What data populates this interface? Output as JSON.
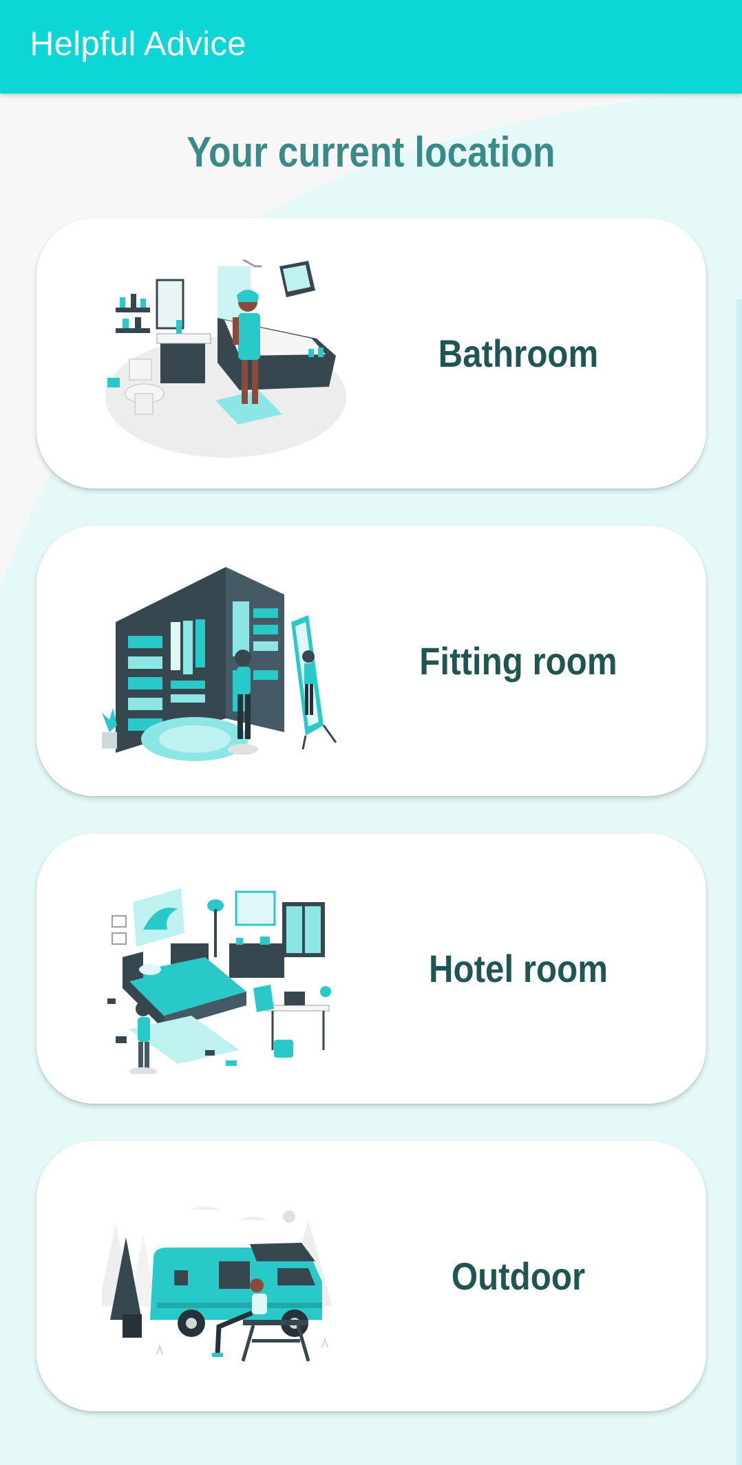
{
  "app_bar": {
    "title": "Helpful Advice"
  },
  "heading": "Your current location",
  "colors": {
    "app_bar": "#0cd6d6",
    "background": "#e6f9f9",
    "heading": "#3a8a8a",
    "card_label": "#1f5553",
    "accent": "#29c9c9",
    "dark": "#37474f"
  },
  "locations": [
    {
      "label": "Bathroom",
      "icon": "bathroom-illustration"
    },
    {
      "label": "Fitting room",
      "icon": "fitting-room-illustration"
    },
    {
      "label": "Hotel room",
      "icon": "hotel-room-illustration"
    },
    {
      "label": "Outdoor",
      "icon": "camper-van-outdoor-illustration"
    }
  ]
}
